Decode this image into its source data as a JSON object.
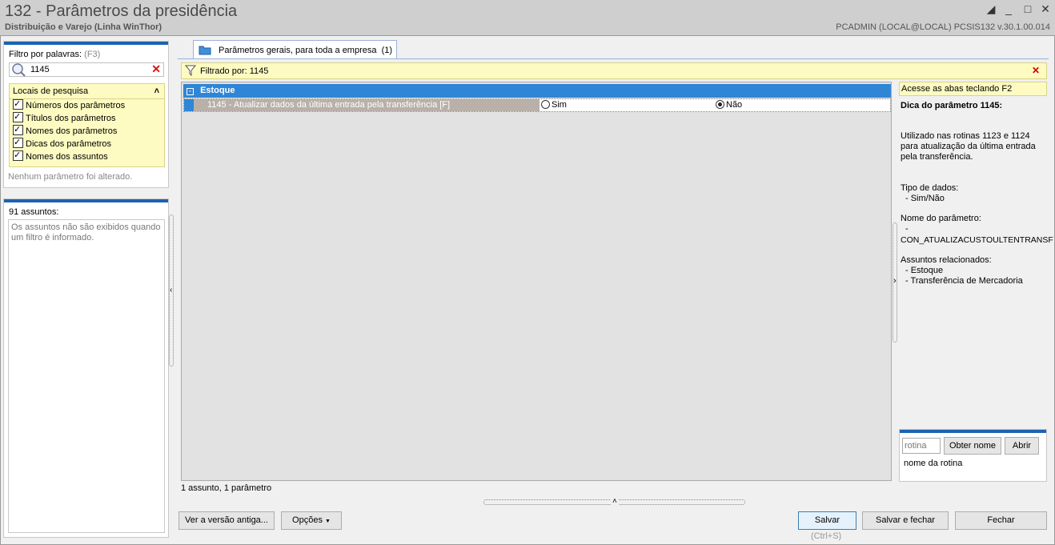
{
  "window": {
    "title": "132 - Parâmetros da presidência",
    "subtitle": "Distribuição e Varejo (Linha WinThor)",
    "user_info": "PCADMIN (LOCAL@LOCAL)   PCSIS132  v.30.1.00.014"
  },
  "filter": {
    "label": "Filtro por palavras:",
    "shortcut": "(F3)",
    "value": "1145",
    "locations_title": "Locais de pesquisa",
    "locations": [
      "Números dos parâmetros",
      "Títulos dos parâmetros",
      "Nomes dos parâmetros",
      "Dicas dos parâmetros",
      "Nomes dos assuntos"
    ],
    "status": "Nenhum parâmetro foi alterado."
  },
  "subjects": {
    "count_label": "91 assuntos:",
    "hint": "Os assuntos não são exibidos quando um filtro é informado."
  },
  "tab": {
    "label": "Parâmetros gerais, para toda a empresa",
    "count": "(1)"
  },
  "filter_bar": {
    "text": "Filtrado por: 1145"
  },
  "grid": {
    "group": "Estoque",
    "row_label": "1145 - Atualizar dados da última entrada pela transferência [F]",
    "option_yes": "Sim",
    "option_no": "Não",
    "selected": "Não",
    "footer": "1 assunto, 1 parâmetro"
  },
  "tip": {
    "tabs_hint": "Acesse as abas teclando F2",
    "heading": "Dica do parâmetro 1145:",
    "desc": "Utilizado nas rotinas 1123 e 1124 para atualização da última entrada pela transferência.",
    "type_label": "Tipo de dados:",
    "type_value": "- Sim/Não",
    "name_label": "Nome do parâmetro:",
    "name_dash": "-",
    "name_value": "CON_ATUALIZACUSTOULTENTRANSF",
    "subjects_label": "Assuntos relacionados:",
    "subject_1": "- Estoque",
    "subject_2": "- Transferência de Mercadoria"
  },
  "routine": {
    "placeholder": "rotina",
    "get_name": "Obter nome",
    "open": "Abrir",
    "name_label": "nome da rotina"
  },
  "buttons": {
    "old_version": "Ver a versão antiga...",
    "options": "Opções",
    "save": "Salvar",
    "save_shortcut": "(Ctrl+S)",
    "save_close": "Salvar e fechar",
    "close": "Fechar"
  }
}
